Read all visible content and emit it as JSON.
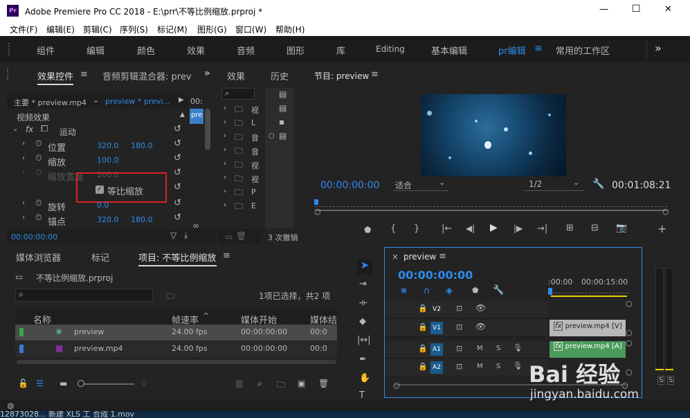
{
  "app": {
    "title": "Adobe Premiere Pro CC 2018 - E:\\prr\\不等比例缩放.prproj *",
    "logo": "Pr",
    "min": "—",
    "max": "☐",
    "close": "✕"
  },
  "menu": [
    "文件(F)",
    "编辑(E)",
    "剪辑(C)",
    "序列(S)",
    "标记(M)",
    "图形(G)",
    "窗口(W)",
    "帮助(H)"
  ],
  "workspaces": [
    "组件",
    "编辑",
    "颜色",
    "效果",
    "音频",
    "图形",
    "库",
    "Editing",
    "基本编辑",
    "pr编辑",
    "常用的工作区"
  ],
  "workspace_menu": "≡",
  "more": "»",
  "effect_controls": {
    "tabs": [
      "效果控件",
      "音频剪辑混合器: prev"
    ],
    "menu": "≡",
    "master": "主要 * preview.mp4",
    "clip": "preview * previ...",
    "clip_label": "pre",
    "time_label": "00:",
    "section": "视频效果",
    "motion": "运动",
    "rows": [
      {
        "name": "位置",
        "v1": "320.0",
        "v2": "180.0"
      },
      {
        "name": "缩放",
        "v1": "100.0",
        "v2": ""
      },
      {
        "name": "缩放宽度",
        "v1": "100.0",
        "v2": ""
      },
      {
        "name": "旋转",
        "v1": "0.0",
        "v2": ""
      },
      {
        "name": "锚点",
        "v1": "320.0",
        "v2": "180.0"
      }
    ],
    "uniform": "等比缩放",
    "timecode": "00:00:00:00"
  },
  "effects": {
    "title": "效果",
    "items": [
      "视",
      "L",
      "音",
      "音",
      "视",
      "视",
      "P",
      "E"
    ]
  },
  "history": {
    "title": "历史",
    "count": "3 次撤销"
  },
  "program": {
    "title": "节目: preview",
    "menu": "≡",
    "time": "00:00:00:00",
    "fit": "适合",
    "res": "1/2",
    "duration": "00:01:08:21"
  },
  "project": {
    "tabs": [
      "媒体浏览器",
      "标记",
      "项目: 不等比例缩放"
    ],
    "menu": "≡",
    "file": "不等比例缩放.prproj",
    "selection": "1项已选择，共2 项",
    "columns": [
      "名称",
      "帧速率",
      "媒体开始",
      "媒体结"
    ],
    "rows": [
      {
        "name": "preview",
        "fps": "24.00 fps",
        "start": "00:00:00:00",
        "end": "00:0",
        "color": "#3aa84a"
      },
      {
        "name": "preview.mp4",
        "fps": "24.00 fps",
        "start": "00:00:00:00",
        "end": "00:0",
        "color": "#3a78d6"
      }
    ]
  },
  "timeline": {
    "close": "×",
    "title": "preview",
    "menu": "≡",
    "time": "00:00:00:00",
    "ruler": [
      ":00:00",
      "00:00:15:00"
    ],
    "tracks": [
      {
        "name": "V2",
        "m": "",
        "s": ""
      },
      {
        "name": "V1",
        "m": "",
        "s": ""
      },
      {
        "name": "A1",
        "m": "M",
        "s": "S"
      },
      {
        "name": "A2",
        "m": "M",
        "s": "S"
      }
    ],
    "clip_v": "preview.mp4 [V]",
    "clip_a": "preview.mp4 [A]",
    "clip_fx": "fx"
  },
  "meter": {
    "solo": [
      "S",
      "S"
    ]
  },
  "taskbar": {
    "text": "12873028... 新建 XLS 工   合成 1.mov"
  },
  "watermark": {
    "brand": "Bai 经验",
    "url": "jingyan.baidu.com"
  },
  "colors": {
    "accent": "#2d8ceb",
    "highlight": "#e02020",
    "panel": "#232323"
  }
}
